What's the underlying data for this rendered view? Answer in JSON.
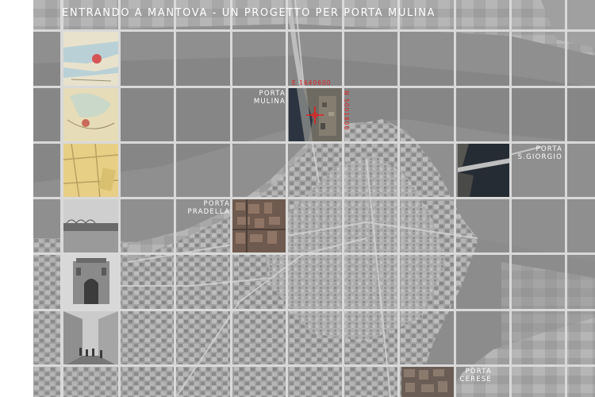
{
  "title": "ENTRANDO A MANTOVA - UN PROGETTO PER PORTA MULINA",
  "gates": {
    "mulina": "PORTA\nMULINA",
    "san_giorgio": "PORTA\nS.GIORGIO",
    "pradella": "PORTA\nPRADELLA",
    "cerese": "PORTA\nCERESE"
  },
  "coords": {
    "east": "E 1640600",
    "north": "N 5001800"
  },
  "colors": {
    "lake": "#8f8f8f",
    "city": "#9c9c9c",
    "grid": "#d9d9d9",
    "accent": "#e02020",
    "label": "#ffffff"
  }
}
